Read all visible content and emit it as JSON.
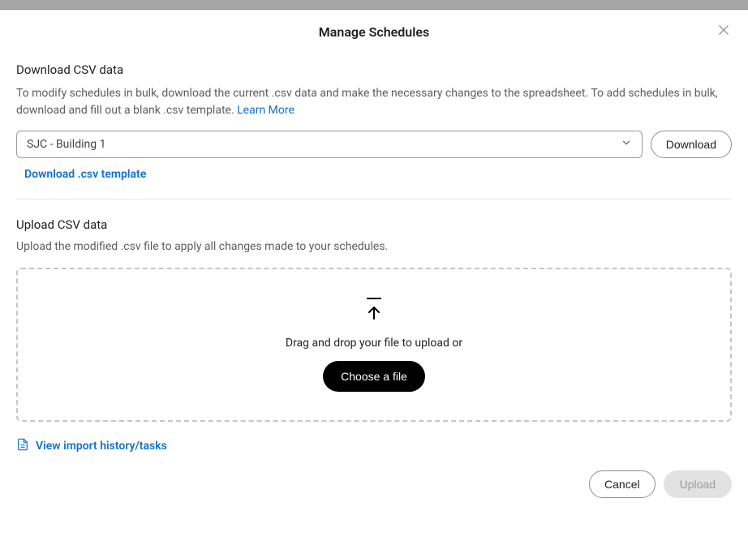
{
  "modal": {
    "title": "Manage Schedules"
  },
  "download": {
    "section_title": "Download CSV data",
    "description_a": "To modify schedules in bulk, download the current .csv data and make the necessary changes to the spreadsheet. To add schedules in bulk, download and fill out a blank .csv template. ",
    "learn_more": "Learn More",
    "selected_location": "SJC - Building 1",
    "download_button": "Download",
    "template_link": "Download .csv template"
  },
  "upload": {
    "section_title": "Upload CSV data",
    "description": "Upload the modified .csv file to apply all changes made to your schedules.",
    "drop_text": "Drag and drop your file to upload or",
    "choose_button": "Choose a file"
  },
  "history": {
    "link": "View import history/tasks"
  },
  "footer": {
    "cancel": "Cancel",
    "upload": "Upload"
  }
}
